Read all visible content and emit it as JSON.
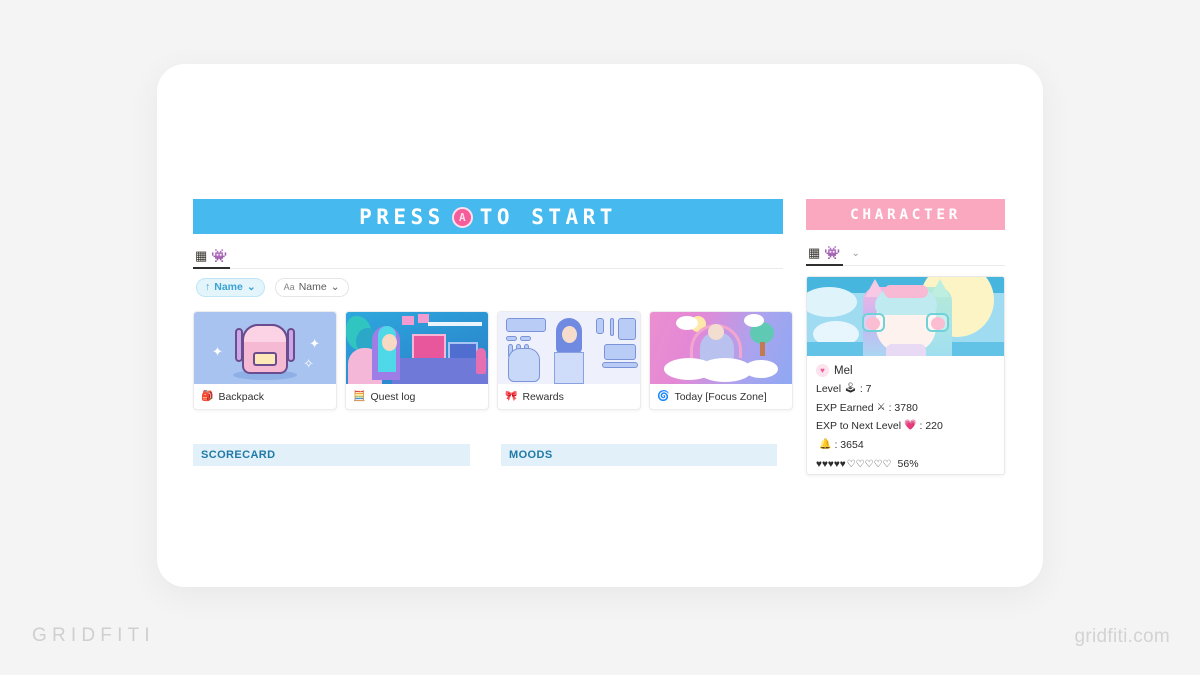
{
  "page": {
    "background": "#f4f4f4",
    "watermark_left": "GRIDFITI",
    "watermark_right": "gridfiti.com"
  },
  "main_panel": {
    "banner": {
      "text_before": "PRESS",
      "badge": "A",
      "text_after": "TO START",
      "background": "#46b9ee",
      "text_color": "#ffffff"
    },
    "tabs": [
      {
        "name": "grid-view",
        "icon": "grid-icon",
        "glyph": "▦",
        "active": true
      },
      {
        "name": "invader-view",
        "icon": "space-invader-icon",
        "glyph": "👾",
        "active": false
      }
    ],
    "filters": [
      {
        "label": "Name",
        "icon": "sort-ascending-icon",
        "glyph": "↑",
        "caret": "⌄",
        "active": true
      },
      {
        "label": "Name",
        "icon": "text-size-icon",
        "glyph": "Aa",
        "caret": "⌄",
        "active": false
      }
    ],
    "cards": [
      {
        "label": "Backpack",
        "icon": "backpack-emoji",
        "glyph": "🎒",
        "art": "backpack"
      },
      {
        "label": "Quest log",
        "icon": "abacus-emoji",
        "glyph": "🧮",
        "art": "questlog"
      },
      {
        "label": "Rewards",
        "icon": "ribbon-emoji",
        "glyph": "🎀",
        "art": "rewards"
      },
      {
        "label": "Today [Focus Zone]",
        "icon": "cyclone-emoji",
        "glyph": "🌀",
        "art": "today"
      }
    ],
    "sections": [
      {
        "label": "SCORECARD",
        "background": "#e2f0fa",
        "text_color": "#1f7aa6"
      },
      {
        "label": "MOODS",
        "background": "#e2f0fa",
        "text_color": "#1f7aa6"
      }
    ]
  },
  "character_panel": {
    "banner": {
      "text": "CHARACTER",
      "background": "#f9a8c0",
      "text_color": "#ffffff"
    },
    "tabs": [
      {
        "name": "grid-view",
        "icon": "grid-icon",
        "glyph": "▦",
        "active": true
      },
      {
        "name": "invader-view",
        "icon": "space-invader-icon",
        "glyph": "👾",
        "active": false
      }
    ],
    "tab_caret": "⌄",
    "card": {
      "name": "Mel",
      "name_icon": "heart-icon",
      "name_glyph": "♥",
      "stats": [
        {
          "label": "Level",
          "glyph": "🕹",
          "icon": "joystick-emoji",
          "value": "7"
        },
        {
          "label": "EXP Earned",
          "glyph": "⚔",
          "icon": "sword-emoji",
          "value": "3780"
        },
        {
          "label": "EXP to Next Level",
          "glyph": "💗",
          "icon": "pink-heart-emoji",
          "value": "220"
        },
        {
          "label": "",
          "glyph": "🔔",
          "icon": "bell-emoji",
          "value": "3654"
        }
      ],
      "progress": {
        "filled": 5,
        "empty": 5,
        "filled_glyph": "♥",
        "empty_glyph": "♡",
        "percent": "56%"
      }
    }
  }
}
